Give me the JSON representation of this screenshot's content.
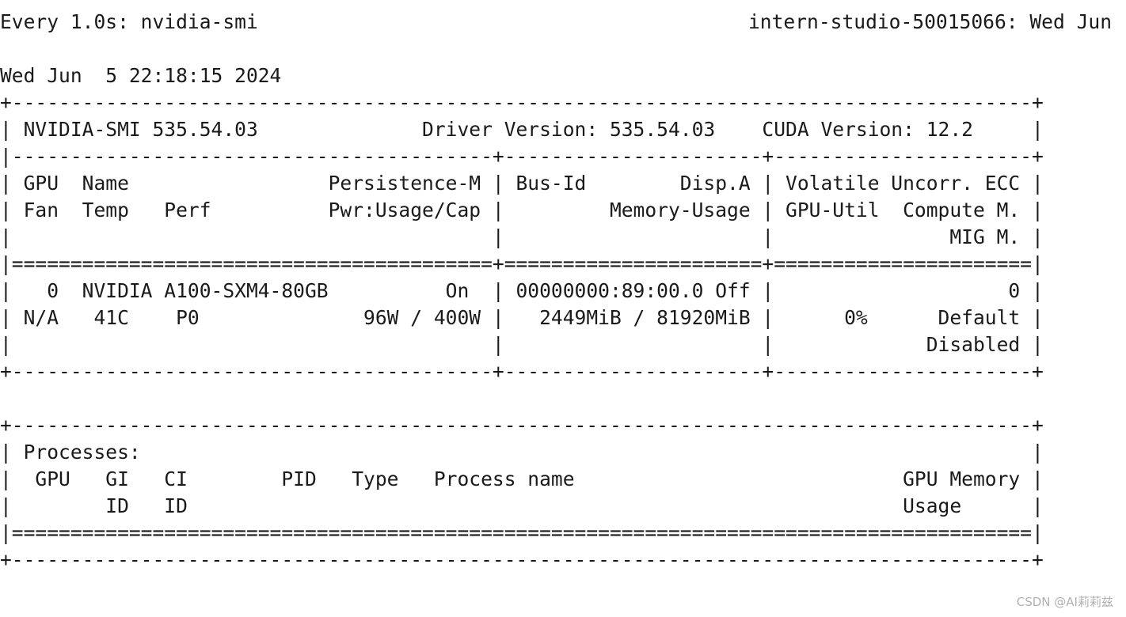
{
  "header": {
    "command": "Every 1.0s: nvidia-smi",
    "host_time": "intern-studio-50015066: Wed Jun"
  },
  "timestamp": "Wed Jun  5 22:18:15 2024",
  "gpu_table": {
    "border_top": "+---------------------------------------------------------------------------------------+",
    "version_line": "| NVIDIA-SMI 535.54.03              Driver Version: 535.54.03    CUDA Version: 12.2     |",
    "separator_1": "|-----------------------------------------+----------------------+----------------------+",
    "header_line_1": "| GPU  Name                 Persistence-M | Bus-Id        Disp.A | Volatile Uncorr. ECC |",
    "header_line_2": "| Fan  Temp   Perf          Pwr:Usage/Cap |         Memory-Usage | GPU-Util  Compute M. |",
    "header_line_3": "|                                         |                      |               MIG M. |",
    "double_separator": "|=========================================+======================+======================|",
    "gpu_line_1": "|   0  NVIDIA A100-SXM4-80GB          On  | 00000000:89:00.0 Off |                    0 |",
    "gpu_line_2": "| N/A   41C    P0              96W / 400W |   2449MiB / 81920MiB |      0%      Default |",
    "gpu_line_3": "|                                         |                      |             Disabled |",
    "border_bottom": "+-----------------------------------------+----------------------+----------------------+"
  },
  "process_table": {
    "border_top": "+---------------------------------------------------------------------------------------+",
    "title_line": "| Processes:                                                                            |",
    "header_line_1": "|  GPU   GI   CI        PID   Type   Process name                            GPU Memory |",
    "header_line_2": "|        ID   ID                                                             Usage      |",
    "double_separator": "|=======================================================================================|",
    "border_bottom": "+---------------------------------------------------------------------------------------+"
  },
  "watermark": "CSDN @AI莉莉兹"
}
